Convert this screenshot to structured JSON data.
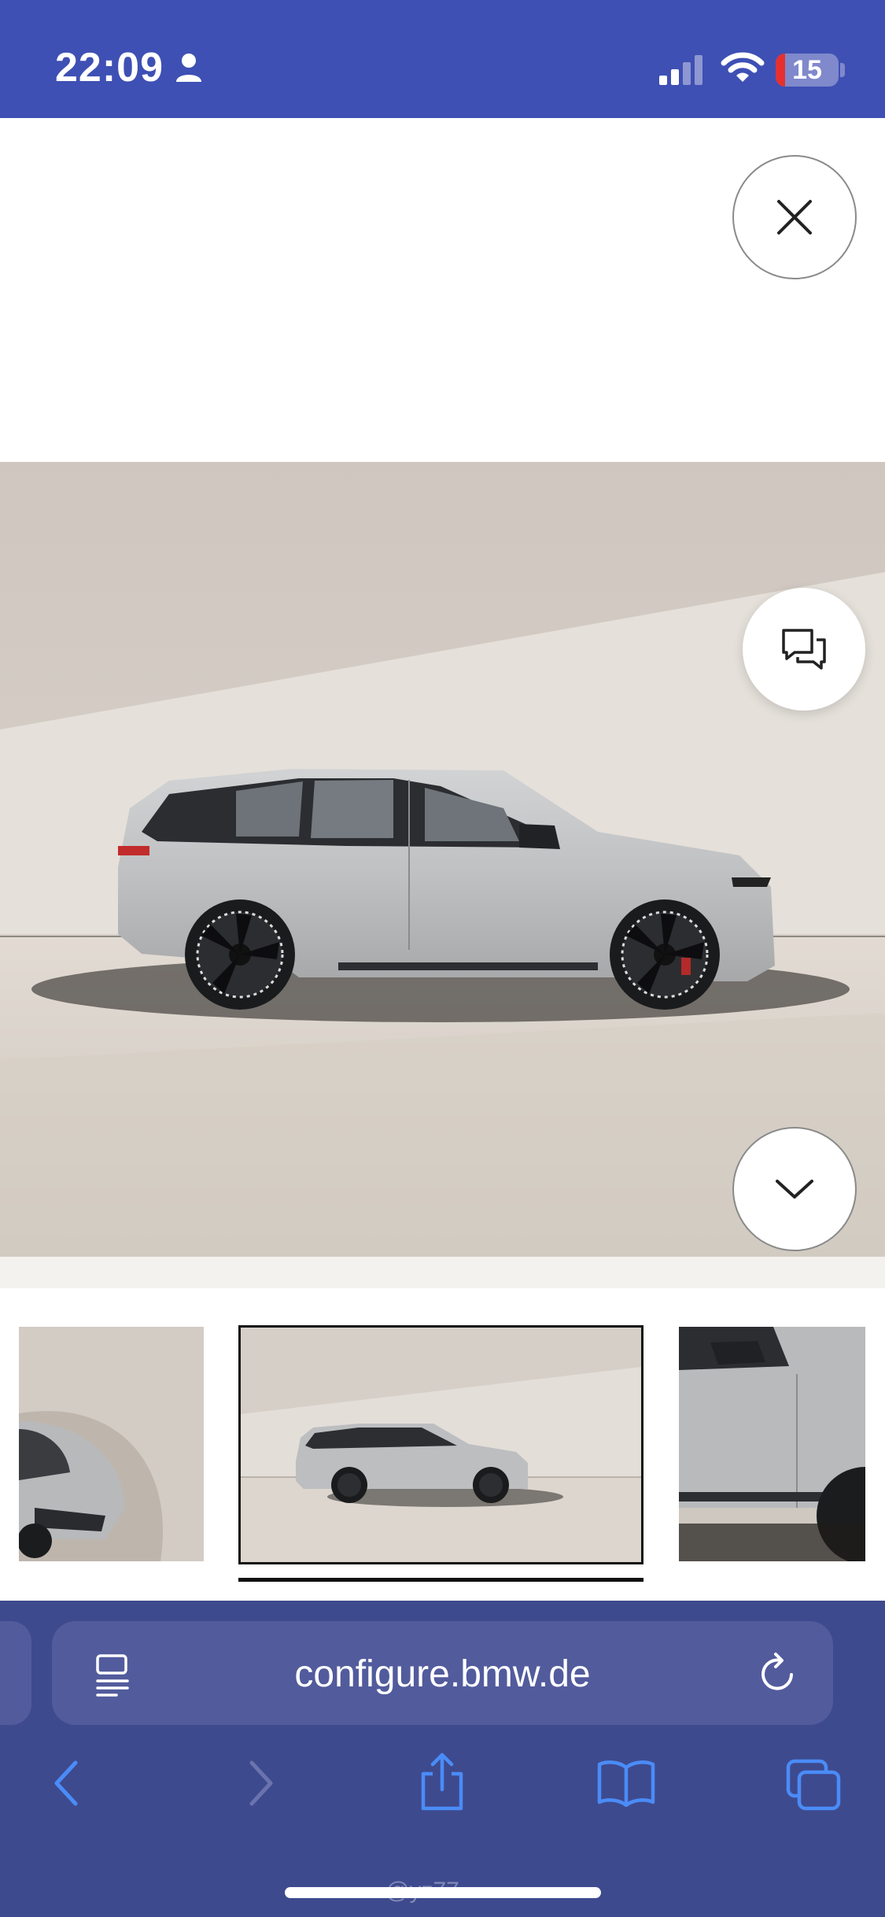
{
  "status_bar": {
    "time": "22:09",
    "battery_level": "15",
    "icons": [
      "person-icon",
      "signal-icon",
      "wifi-icon",
      "battery-icon"
    ]
  },
  "controls": {
    "close_icon": "close-icon",
    "chat_icon": "chat-icon",
    "expand_icon": "chevron-down-icon"
  },
  "gallery": {
    "thumbnails": [
      {
        "label": "front-quarter-view",
        "selected": false
      },
      {
        "label": "side-view",
        "selected": true
      },
      {
        "label": "door-detail-view",
        "selected": false
      }
    ]
  },
  "browser": {
    "url": "configure.bmw.de",
    "icons": [
      "reader-icon",
      "reload-icon",
      "back-icon",
      "forward-icon",
      "share-icon",
      "bookmarks-icon",
      "tabs-icon"
    ]
  },
  "watermark": "@yz77",
  "colors": {
    "status_bar": "#3e50b4",
    "browser_bar": "#3e4a8e",
    "url_field": "#525b9c",
    "accent_blue": "#4a8cf7"
  }
}
